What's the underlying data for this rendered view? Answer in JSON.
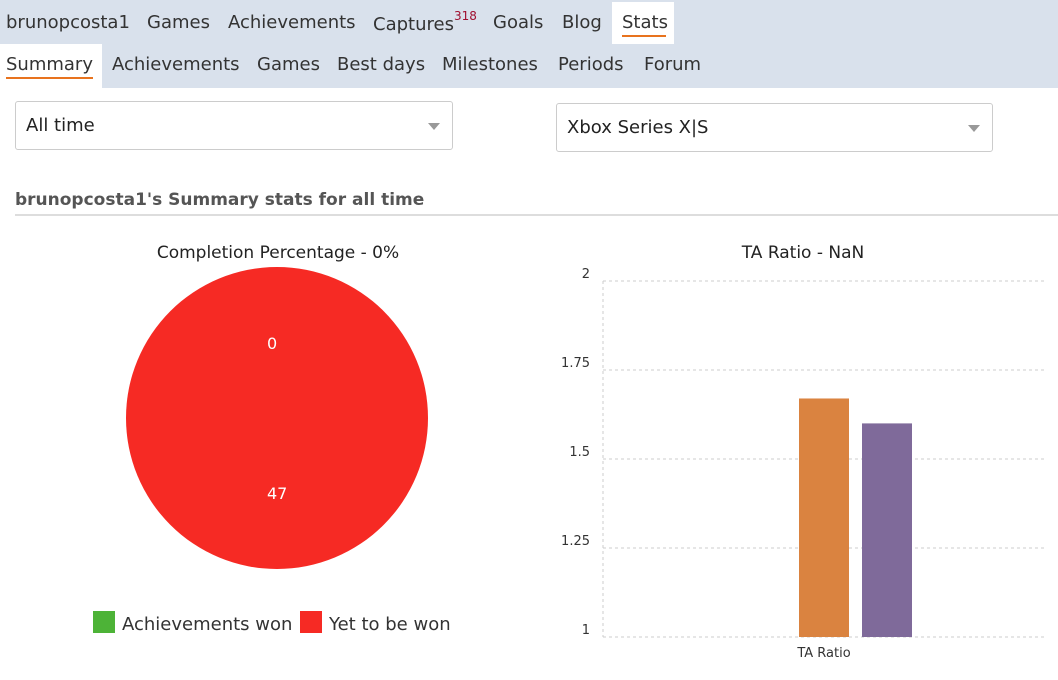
{
  "nav": {
    "user": "brunopcosta1",
    "items": [
      "Games",
      "Achievements",
      "Captures",
      "Goals",
      "Blog",
      "Stats"
    ],
    "captures_count": "318",
    "active": "Stats"
  },
  "subnav": {
    "items": [
      "Summary",
      "Achievements",
      "Games",
      "Best days",
      "Milestones",
      "Periods",
      "Forum"
    ],
    "active": "Summary"
  },
  "filters": {
    "period": "All time",
    "platform": "Xbox Series X|S"
  },
  "heading": "brunopcosta1's Summary stats for all time",
  "chart_data": [
    {
      "type": "pie",
      "title": "Completion Percentage - 0%",
      "labels": [
        "Achievements won",
        "Yet to be won"
      ],
      "values": [
        0,
        47
      ],
      "colors": [
        "#4db337",
        "#f62a24"
      ]
    },
    {
      "type": "bar",
      "title": "TA Ratio - NaN",
      "categories": [
        "TA Ratio"
      ],
      "series": [
        {
          "values": [
            1.67
          ],
          "color": "#da8340"
        },
        {
          "values": [
            1.6
          ],
          "color": "#7f6a9a"
        }
      ],
      "yticks": [
        "2",
        "1.75",
        "1.5",
        "1.25",
        "1"
      ],
      "ylim": [
        1,
        2
      ],
      "grid": true
    }
  ]
}
